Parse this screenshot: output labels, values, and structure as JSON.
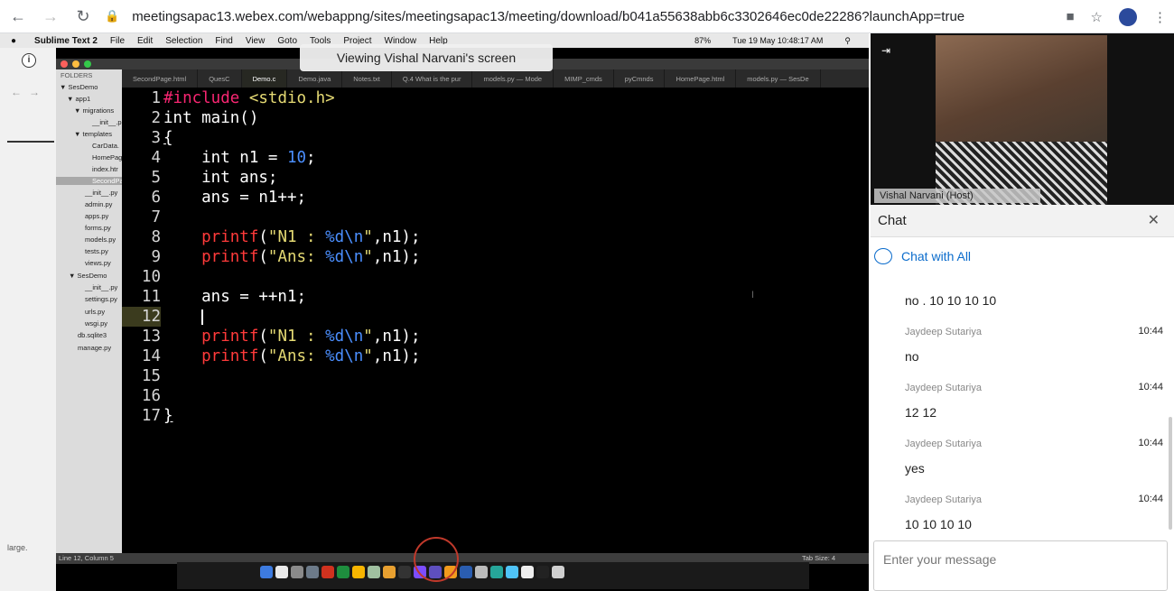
{
  "browser": {
    "url": "meetingsapac13.webex.com/webappng/sites/meetingsapac13/meeting/download/b041a55638abb6c3302646ec0de22286?launchApp=true"
  },
  "share": {
    "toast": "Viewing Vishal Narvani's screen",
    "menubar": {
      "app": "Sublime Text 2",
      "items": [
        "File",
        "Edit",
        "Selection",
        "Find",
        "View",
        "Goto",
        "Tools",
        "Project",
        "Window",
        "Help"
      ],
      "battery": "87%",
      "clock": "Tue 19 May  10:48:17 AM"
    },
    "left_download": "large.",
    "tabs": [
      "SecondPage.html",
      "QuesC",
      "Demo.c",
      "Demo.java",
      "Notes.txt",
      "Q.4 What is the pur",
      "models.py — Mode",
      "MIMP_cmds",
      "pyCmnds",
      "HomePage.html",
      "models.py — SesDe"
    ],
    "sidebar": {
      "header": "FOLDERS",
      "items": [
        "SesDemo",
        "app1",
        "migrations",
        "__init__.p",
        "templates",
        "CarData.",
        "HomePag",
        "index.htr",
        "SecondPa",
        "__init__.py",
        "admin.py",
        "apps.py",
        "forms.py",
        "models.py",
        "tests.py",
        "views.py",
        "SesDemo",
        "__init__.py",
        "settings.py",
        "urls.py",
        "wsgi.py",
        "db.sqlite3",
        "manage.py"
      ]
    },
    "status_left": "Line 12, Column 5",
    "status_right": "Tab Size: 4",
    "code": {
      "l1a": "#include",
      "l1b": " <stdio.h>",
      "l2": "int main()",
      "l3": "{",
      "l4a": "    int n1 = ",
      "l4b": "10",
      "l4c": ";",
      "l5": "    int ans;",
      "l6": "    ans = n1++;",
      "l8a": "    printf",
      "l8b": "(",
      "l8c": "\"N1 : ",
      "l8d": "%d\\n",
      "l8e": "\"",
      "l8f": ",n1);",
      "l9a": "    printf",
      "l9b": "(",
      "l9c": "\"Ans: ",
      "l9d": "%d\\n",
      "l9e": "\"",
      "l9f": ",n1);",
      "l11": "    ans = ++n1;",
      "l12": "    ",
      "l13a": "    printf",
      "l13b": "(",
      "l13c": "\"N1 : ",
      "l13d": "%d\\n",
      "l13e": "\"",
      "l13f": ",n1);",
      "l14a": "    printf",
      "l14b": "(",
      "l14c": "\"Ans: ",
      "l14d": "%d\\n",
      "l14e": "\"",
      "l14f": ",n1);",
      "l17": "}"
    },
    "line_numbers": [
      "1",
      "2",
      "3",
      "4",
      "5",
      "6",
      "7",
      "8",
      "9",
      "10",
      "11",
      "12",
      "13",
      "14",
      "15",
      "16",
      "17"
    ]
  },
  "video": {
    "name": "Vishal Narvani (Host)"
  },
  "chat": {
    "title": "Chat",
    "with": "Chat with All",
    "first_message": "no . 10 10 10 10",
    "messages": [
      {
        "author": "Jaydeep Sutariya",
        "time": "10:44",
        "text": "no"
      },
      {
        "author": "Jaydeep Sutariya",
        "time": "10:44",
        "text": "12 12"
      },
      {
        "author": "Jaydeep Sutariya",
        "time": "10:44",
        "text": "yes"
      },
      {
        "author": "Jaydeep Sutariya",
        "time": "10:44",
        "text": "10 10 10 10"
      }
    ],
    "input_placeholder": "Enter your message"
  }
}
